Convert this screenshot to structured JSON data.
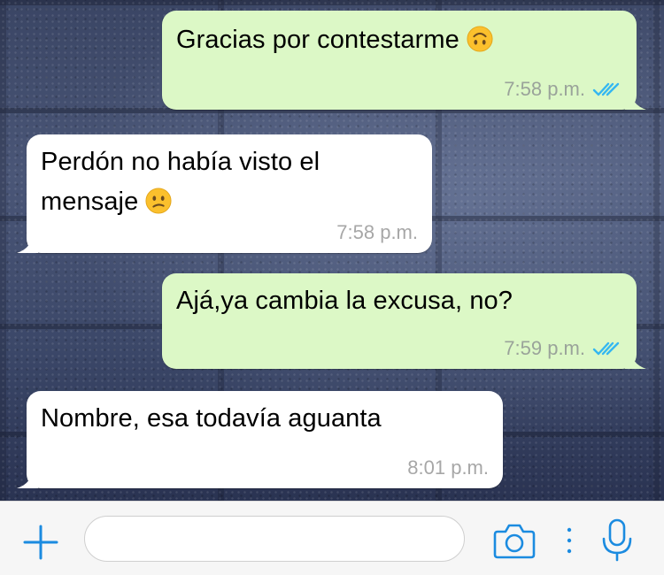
{
  "chat": {
    "messages": [
      {
        "direction": "outgoing",
        "text": "Gracias por contestarme",
        "emoji": "upside-down-face-emoji",
        "time": "7:58 p.m.",
        "status": "read-double-check-icon"
      },
      {
        "direction": "incoming",
        "text_line1": "Perdón no había visto el",
        "text_line2": "mensaje",
        "emoji": "confused-face-emoji",
        "time": "7:58 p.m."
      },
      {
        "direction": "outgoing",
        "text": "Ajá,ya cambia la excusa, no?",
        "time": "7:59 p.m.",
        "status": "read-double-check-icon"
      },
      {
        "direction": "incoming",
        "text": "Nombre, esa todavía aguanta",
        "time": "8:01 p.m."
      }
    ]
  },
  "input_bar": {
    "message_value": "",
    "message_placeholder": "",
    "icons": [
      "plus-icon",
      "camera-icon",
      "more-dots-icon",
      "microphone-icon"
    ]
  },
  "colors": {
    "outgoing_bubble": "#dcf8c6",
    "incoming_bubble": "#ffffff",
    "accent": "#1b8be0",
    "read_ticks": "#34b7f1"
  }
}
